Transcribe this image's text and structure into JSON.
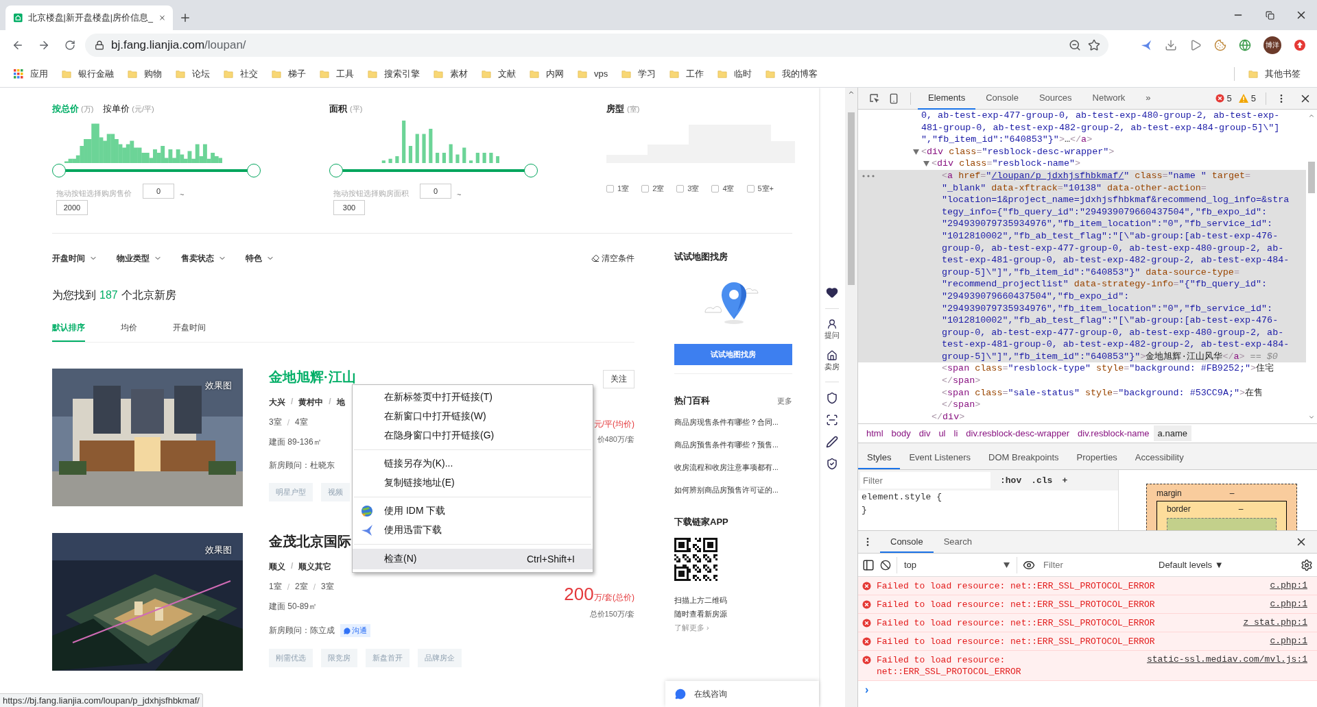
{
  "browser": {
    "tab": {
      "title": "北京楼盘|新开盘楼盘|房价信息_"
    },
    "url": {
      "host": "bj.fang.lianjia.com",
      "path": "/loupan/"
    },
    "profile": {
      "avatar_text": "博洋"
    },
    "bookmarks": [
      {
        "label": "应用",
        "kind": "apps"
      },
      {
        "label": "银行金融",
        "kind": "folder"
      },
      {
        "label": "购物",
        "kind": "folder"
      },
      {
        "label": "论坛",
        "kind": "folder"
      },
      {
        "label": "社交",
        "kind": "folder"
      },
      {
        "label": "梯子",
        "kind": "folder"
      },
      {
        "label": "工具",
        "kind": "folder"
      },
      {
        "label": "搜索引擎",
        "kind": "folder"
      },
      {
        "label": "素材",
        "kind": "folder"
      },
      {
        "label": "文献",
        "kind": "folder"
      },
      {
        "label": "内网",
        "kind": "folder"
      },
      {
        "label": "vps",
        "kind": "folder"
      },
      {
        "label": "学习",
        "kind": "folder"
      },
      {
        "label": "工作",
        "kind": "folder"
      },
      {
        "label": "临时",
        "kind": "folder"
      },
      {
        "label": "我的博客",
        "kind": "folder"
      }
    ],
    "other_bookmarks": "其他书签",
    "status_url": "https://bj.fang.lianjia.com/loupan/p_jdxhjsfhbkmaf/"
  },
  "filters": {
    "price": {
      "modes": [
        {
          "label": "按总价",
          "unit": "(万)",
          "selected": true
        },
        {
          "label": "按单价",
          "unit": "(元/平)",
          "selected": false
        }
      ],
      "slider": {
        "level": 1
      },
      "hint": "拖动按钮选择购房售价",
      "min": "0",
      "sep": "~",
      "max": "2000"
    },
    "area": {
      "label": "面积",
      "unit": "(平)",
      "slider": {
        "level": 1
      },
      "hint": "拖动按钮选择购房面积",
      "min": "0",
      "sep": "~",
      "max": "300"
    },
    "rooms": {
      "label": "房型",
      "unit": "(室)",
      "options": [
        {
          "label": "1室",
          "checked": false
        },
        {
          "label": "2室",
          "checked": false
        },
        {
          "label": "3室",
          "checked": false
        },
        {
          "label": "4室",
          "checked": false
        },
        {
          "label": "5室+",
          "checked": false
        }
      ]
    }
  },
  "dropdowns": [
    "开盘时间",
    "物业类型",
    "售卖状态",
    "特色"
  ],
  "clear": "清空条件",
  "result": {
    "before": "为您找到",
    "count": "187",
    "after": "个北京新房"
  },
  "sort_tabs": [
    {
      "label": "默认排序",
      "selected": true
    },
    {
      "label": "均价",
      "selected": false
    },
    {
      "label": "开盘时间",
      "selected": false
    }
  ],
  "listings": [
    {
      "title": "金地旭辉·江山",
      "image": {
        "kind": "picture",
        "label": "效果图"
      },
      "separator": "/",
      "location": [
        "大兴",
        "黄村中",
        "地"
      ],
      "rooms": [
        "3室",
        "4室"
      ],
      "area": "建面 89-136㎡",
      "advisor": "新房顾问：杜晓东",
      "tags": [
        "明星户型",
        "视频"
      ],
      "follow": "关注",
      "price_unit": "元/平(均价)",
      "total": "价480万/套"
    },
    {
      "title": "金茂北京国际",
      "image": {
        "kind": "picture",
        "label": "效果图"
      },
      "separator": "/",
      "location": [
        "顺义",
        "顺义其它"
      ],
      "rooms": [
        "1室",
        "2室",
        "3室"
      ],
      "area": "建面 50-89㎡",
      "advisor": "新房顾问：陈立成",
      "chat": "沟通",
      "tags": [
        "刚需优选",
        "限竞房",
        "新盘首开",
        "品牌房企"
      ],
      "price": "200",
      "price_unit": "万/套(总价)",
      "total": "总价150万/套"
    }
  ],
  "sidebar": {
    "map_title": "试试地图找房",
    "map_button": "试试地图找房",
    "wiki_title": "热门百科",
    "wiki_more": "更多",
    "wiki_links": [
      "商品房现售条件有哪些？合同...",
      "商品房预售条件有哪些？预售...",
      "收房流程和收房注意事项都有...",
      "如何辨别商品房预售许可证的..."
    ],
    "app_title": "下载链家APP",
    "app_lines": [
      "扫描上方二维码",
      "随时查看新房源"
    ],
    "app_more": "了解更多 ›"
  },
  "side_tools": [
    {
      "label": "提问"
    },
    {
      "label": "卖房"
    }
  ],
  "online_chat": "在线咨询",
  "context_menu": {
    "groups": [
      [
        {
          "label": "在新标签页中打开链接(T)",
          "kind": "plain",
          "highlighted": false
        },
        {
          "label": "在新窗口中打开链接(W)",
          "kind": "plain",
          "highlighted": false
        },
        {
          "label": "在隐身窗口中打开链接(G)",
          "kind": "plain",
          "highlighted": false
        }
      ],
      [
        {
          "label": "链接另存为(K)...",
          "kind": "plain",
          "highlighted": false
        },
        {
          "label": "复制链接地址(E)",
          "kind": "plain",
          "highlighted": false
        }
      ],
      [
        {
          "label": "使用 IDM 下载",
          "kind": "globe",
          "highlighted": false
        },
        {
          "label": "使用迅雷下载",
          "kind": "bird",
          "highlighted": false
        }
      ],
      [
        {
          "label": "检查(N)",
          "kind": "plain",
          "shortcut": "Ctrl+Shift+I",
          "highlighted": true
        }
      ]
    ]
  },
  "devtools": {
    "tabs": [
      {
        "label": "Elements",
        "selected": true
      },
      {
        "label": "Console",
        "selected": false
      },
      {
        "label": "Sources",
        "selected": false
      },
      {
        "label": "Network",
        "selected": false
      }
    ],
    "more": "»",
    "errors": "5",
    "warnings": "5",
    "dom": [
      {
        "lines": [
          [
            {
              "kind": "value",
              "text": "0, ab-test-exp-477-group-0, ab-test-exp-480-group-2, ab-test-exp-"
            }
          ],
          [
            {
              "kind": "value",
              "text": "481-group-0, ab-test-exp-482-group-2, ab-test-exp-484-group-5]\\\"]"
            }
          ],
          [
            {
              "kind": "value",
              "text": "\",\"fb_item_id\":\"640853\"}\""
            },
            {
              "kind": "punct",
              "text": ">"
            },
            {
              "kind": "text",
              "text": "…"
            },
            {
              "kind": "punct",
              "text": "</"
            },
            {
              "kind": "tag",
              "text": "a"
            },
            {
              "kind": "punct",
              "text": ">"
            }
          ]
        ]
      },
      {
        "expanded": true,
        "lines": [
          [
            {
              "kind": "punct",
              "text": "<"
            },
            {
              "kind": "tag",
              "text": "div"
            },
            {
              "kind": "attr",
              "text": " class"
            },
            {
              "kind": "punct",
              "text": "="
            },
            {
              "kind": "value",
              "text": "\"resblock-desc-wrapper\""
            },
            {
              "kind": "punct",
              "text": ">"
            }
          ]
        ],
        "children": [
          {
            "expanded": true,
            "lines": [
              [
                {
                  "kind": "punct",
                  "text": "<"
                },
                {
                  "kind": "tag",
                  "text": "div"
                },
                {
                  "kind": "attr",
                  "text": " class"
                },
                {
                  "kind": "punct",
                  "text": "="
                },
                {
                  "kind": "value",
                  "text": "\"resblock-name\""
                },
                {
                  "kind": "punct",
                  "text": ">"
                }
              ]
            ],
            "children": [
              {
                "selected": true,
                "lines": [
                  [
                    {
                      "kind": "punct",
                      "text": "<"
                    },
                    {
                      "kind": "tag",
                      "text": "a"
                    },
                    {
                      "kind": "attr",
                      "text": " href"
                    },
                    {
                      "kind": "punct",
                      "text": "="
                    },
                    {
                      "kind": "value",
                      "text": "\""
                    },
                    {
                      "kind": "link",
                      "text": "/loupan/p_jdxhjsfhbkmaf/"
                    },
                    {
                      "kind": "value",
                      "text": "\""
                    },
                    {
                      "kind": "attr",
                      "text": " class"
                    },
                    {
                      "kind": "punct",
                      "text": "="
                    },
                    {
                      "kind": "value",
                      "text": "\"name \""
                    },
                    {
                      "kind": "attr",
                      "text": " target"
                    },
                    {
                      "kind": "punct",
                      "text": "="
                    }
                  ],
                  [
                    {
                      "kind": "value",
                      "text": "\"_blank\""
                    },
                    {
                      "kind": "attr",
                      "text": " data-xftrack"
                    },
                    {
                      "kind": "punct",
                      "text": "="
                    },
                    {
                      "kind": "value",
                      "text": "\"10138\""
                    },
                    {
                      "kind": "attr",
                      "text": " data-other-action"
                    },
                    {
                      "kind": "punct",
                      "text": "="
                    }
                  ],
                  [
                    {
                      "kind": "value",
                      "text": "\"location=1&project_name=jdxhjsfhbkmaf&recommend_log_info=&stra"
                    }
                  ],
                  [
                    {
                      "kind": "value",
                      "text": "tegy_info={\"fb_query_id\":\"294939079660437504\",\"fb_expo_id\":"
                    }
                  ],
                  [
                    {
                      "kind": "value",
                      "text": "\"294939079735934976\",\"fb_item_location\":\"0\",\"fb_service_id\":"
                    }
                  ],
                  [
                    {
                      "kind": "value",
                      "text": "\"1012810002\",\"fb_ab_test_flag\":\"[\\\"ab-group:[ab-test-exp-476-"
                    }
                  ],
                  [
                    {
                      "kind": "value",
                      "text": "group-0, ab-test-exp-477-group-0, ab-test-exp-480-group-2, ab-"
                    }
                  ],
                  [
                    {
                      "kind": "value",
                      "text": "test-exp-481-group-0, ab-test-exp-482-group-2, ab-test-exp-484-"
                    }
                  ],
                  [
                    {
                      "kind": "value",
                      "text": "group-5]\\\"]\",\"fb_item_id\":\"640853\"}\""
                    },
                    {
                      "kind": "attr",
                      "text": " data-source-type"
                    },
                    {
                      "kind": "punct",
                      "text": "="
                    }
                  ],
                  [
                    {
                      "kind": "value",
                      "text": "\"recommend_projectlist\""
                    },
                    {
                      "kind": "attr",
                      "text": " data-strategy-info"
                    },
                    {
                      "kind": "punct",
                      "text": "="
                    },
                    {
                      "kind": "value",
                      "text": "\"{\"fb_query_id\":"
                    }
                  ],
                  [
                    {
                      "kind": "value",
                      "text": "\"294939079660437504\",\"fb_expo_id\":"
                    }
                  ],
                  [
                    {
                      "kind": "value",
                      "text": "\"294939079735934976\",\"fb_item_location\":\"0\",\"fb_service_id\":"
                    }
                  ],
                  [
                    {
                      "kind": "value",
                      "text": "\"1012810002\",\"fb_ab_test_flag\":\"[\\\"ab-group:[ab-test-exp-476-"
                    }
                  ],
                  [
                    {
                      "kind": "value",
                      "text": "group-0, ab-test-exp-477-group-0, ab-test-exp-480-group-2, ab-"
                    }
                  ],
                  [
                    {
                      "kind": "value",
                      "text": "test-exp-481-group-0, ab-test-exp-482-group-2, ab-test-exp-484-"
                    }
                  ],
                  [
                    {
                      "kind": "value",
                      "text": "group-5]\\\"]\",\"fb_item_id\":\"640853\"}\""
                    },
                    {
                      "kind": "punct",
                      "text": ">"
                    },
                    {
                      "kind": "text",
                      "text": "金地旭辉·江山风华"
                    },
                    {
                      "kind": "punct",
                      "text": "</"
                    },
                    {
                      "kind": "tag",
                      "text": "a"
                    },
                    {
                      "kind": "punct",
                      "text": ">"
                    },
                    {
                      "kind": "dim",
                      "text": " == $0"
                    }
                  ]
                ]
              },
              {
                "lines": [
                  [
                    {
                      "kind": "punct",
                      "text": "<"
                    },
                    {
                      "kind": "tag",
                      "text": "span"
                    },
                    {
                      "kind": "attr",
                      "text": " class"
                    },
                    {
                      "kind": "punct",
                      "text": "="
                    },
                    {
                      "kind": "value",
                      "text": "\"resblock-type\""
                    },
                    {
                      "kind": "attr",
                      "text": " style"
                    },
                    {
                      "kind": "punct",
                      "text": "="
                    },
                    {
                      "kind": "value",
                      "text": "\"background: #FB9252;\""
                    },
                    {
                      "kind": "punct",
                      "text": ">"
                    },
                    {
                      "kind": "text",
                      "text": "住宅"
                    }
                  ],
                  [
                    {
                      "kind": "punct",
                      "text": "</"
                    },
                    {
                      "kind": "tag",
                      "text": "span"
                    },
                    {
                      "kind": "punct",
                      "text": ">"
                    }
                  ]
                ]
              },
              {
                "lines": [
                  [
                    {
                      "kind": "punct",
                      "text": "<"
                    },
                    {
                      "kind": "tag",
                      "text": "span"
                    },
                    {
                      "kind": "attr",
                      "text": " class"
                    },
                    {
                      "kind": "punct",
                      "text": "="
                    },
                    {
                      "kind": "value",
                      "text": "\"sale-status\""
                    },
                    {
                      "kind": "attr",
                      "text": " style"
                    },
                    {
                      "kind": "punct",
                      "text": "="
                    },
                    {
                      "kind": "value",
                      "text": "\"background: #53CC9A;\""
                    },
                    {
                      "kind": "punct",
                      "text": ">"
                    },
                    {
                      "kind": "text",
                      "text": "在售"
                    }
                  ],
                  [
                    {
                      "kind": "punct",
                      "text": "</"
                    },
                    {
                      "kind": "tag",
                      "text": "span"
                    },
                    {
                      "kind": "punct",
                      "text": ">"
                    }
                  ]
                ]
              }
            ],
            "close": [
              {
                "kind": "punct",
                "text": "</"
              },
              {
                "kind": "tag",
                "text": "div"
              },
              {
                "kind": "punct",
                "text": ">"
              }
            ]
          }
        ]
      }
    ],
    "breadcrumb": [
      {
        "label": "html",
        "selected": false
      },
      {
        "label": "body",
        "selected": false
      },
      {
        "label": "div",
        "selected": false
      },
      {
        "label": "ul",
        "selected": false
      },
      {
        "label": "li",
        "selected": false
      },
      {
        "label": "div.resblock-desc-wrapper",
        "selected": false
      },
      {
        "label": "div.resblock-name",
        "selected": false
      },
      {
        "label": "a.name",
        "selected": true
      }
    ],
    "style_tabs": [
      {
        "label": "Styles",
        "selected": true
      },
      {
        "label": "Event Listeners",
        "selected": false
      },
      {
        "label": "DOM Breakpoints",
        "selected": false
      },
      {
        "label": "Properties",
        "selected": false
      },
      {
        "label": "Accessibility",
        "selected": false
      }
    ],
    "styles": {
      "filter_placeholder": "Filter",
      "hov": ":hov",
      "cls": ".cls",
      "add": "+",
      "rule_open": "element.style {",
      "rule_close": "}"
    },
    "box_model": {
      "margin": "margin",
      "margin_value": "–",
      "border": "border",
      "border_value": "–"
    },
    "drawer_tabs": [
      {
        "label": "Console",
        "selected": true
      },
      {
        "label": "Search",
        "selected": false
      }
    ],
    "console": {
      "context": "top",
      "filter_placeholder": "Filter",
      "levels": "Default levels ▼",
      "messages": [
        {
          "text": "Failed to load resource: net::ERR_SSL_PROTOCOL_ERROR",
          "source": "c.php:1"
        },
        {
          "text": "Failed to load resource: net::ERR_SSL_PROTOCOL_ERROR",
          "source": "c.php:1"
        },
        {
          "text": "Failed to load resource: net::ERR_SSL_PROTOCOL_ERROR",
          "source": "z_stat.php:1"
        },
        {
          "text": "Failed to load resource: net::ERR_SSL_PROTOCOL_ERROR",
          "source": "c.php:1"
        },
        {
          "text": "Failed to load resource: net::ERR_SSL_PROTOCOL_ERROR",
          "source": "static-ssl.mediav.com/mvl.js:1"
        }
      ],
      "prompt": "›"
    }
  }
}
